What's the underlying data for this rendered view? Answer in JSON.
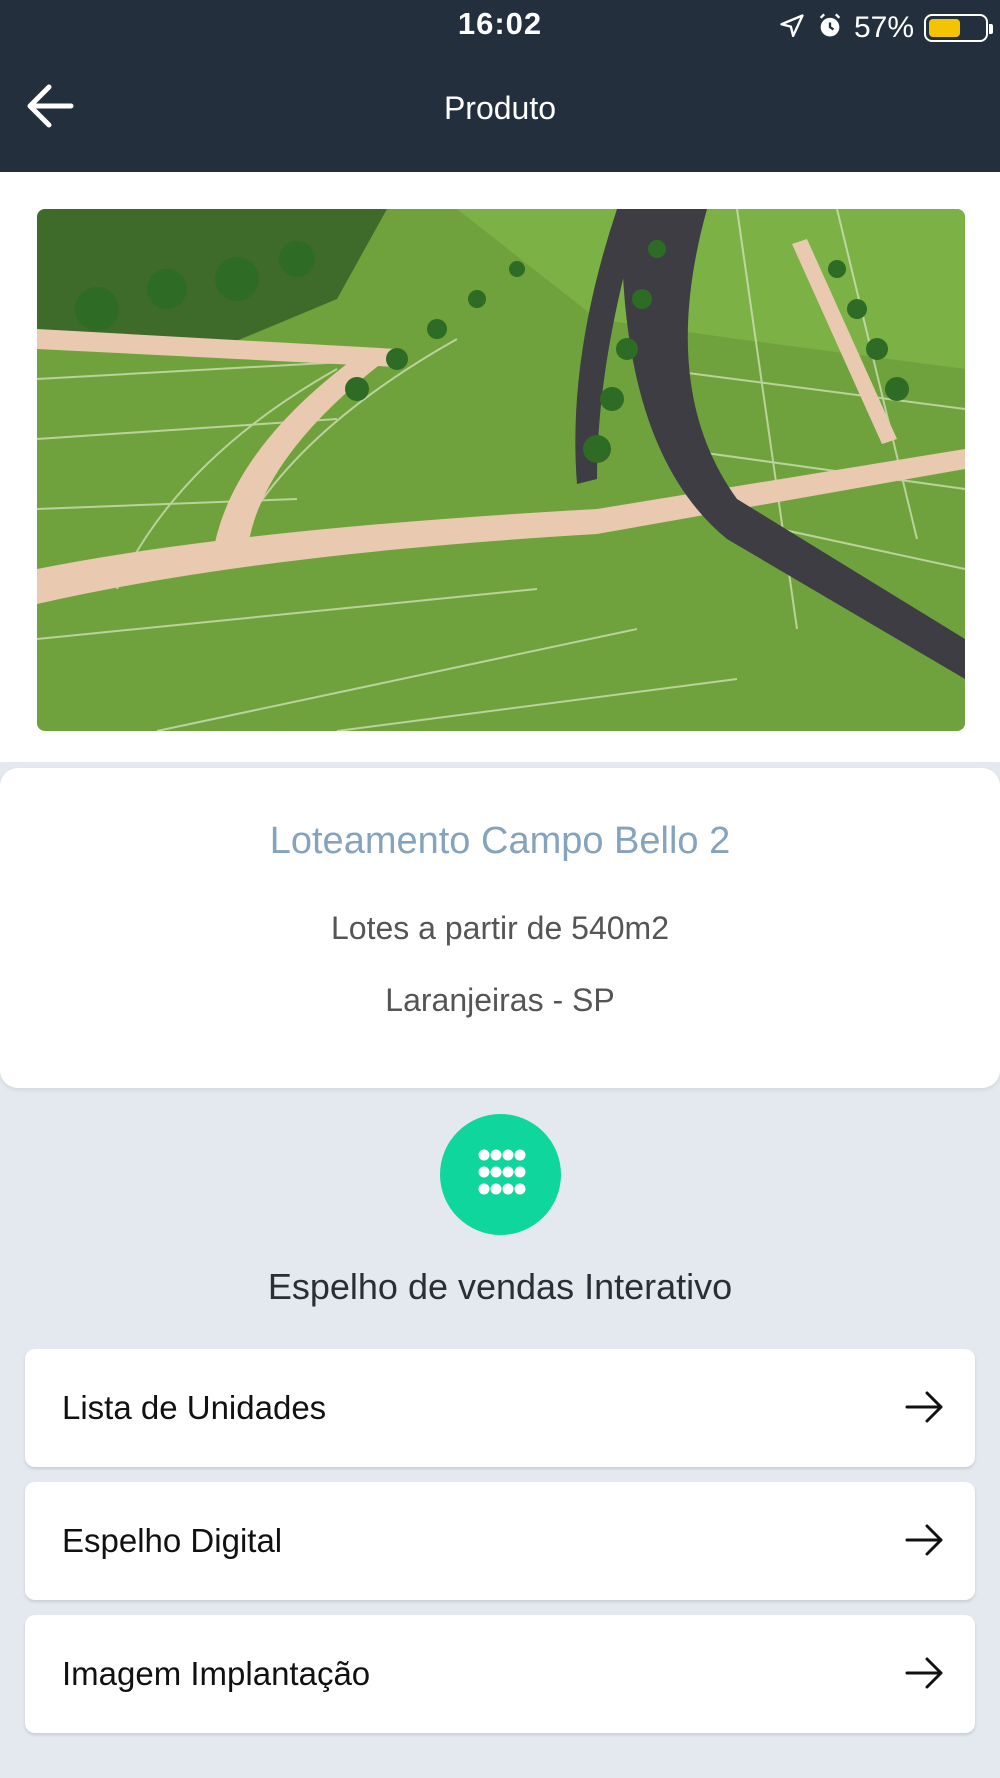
{
  "status": {
    "time": "16:02",
    "battery_text": "57%",
    "battery_level": 0.57,
    "battery_color": "#f5c400"
  },
  "nav": {
    "title": "Produto",
    "back_icon": "arrow-left-icon"
  },
  "product": {
    "title": "Loteamento Campo Bello 2",
    "subtitle": "Lotes a partir de 540m2",
    "location": "Laranjeiras - SP"
  },
  "section": {
    "icon": "grid-dots-icon",
    "accent": "#0fd69d",
    "title": "Espelho de vendas Interativo"
  },
  "menu": [
    {
      "label": "Lista de Unidades",
      "icon": "arrow-right-icon"
    },
    {
      "label": "Espelho Digital",
      "icon": "arrow-right-icon"
    },
    {
      "label": "Imagem Implantação",
      "icon": "arrow-right-icon"
    }
  ],
  "colors": {
    "header_bg": "#232f3d",
    "page_bg": "#e3e9ef",
    "title_color": "#86a3bd"
  }
}
